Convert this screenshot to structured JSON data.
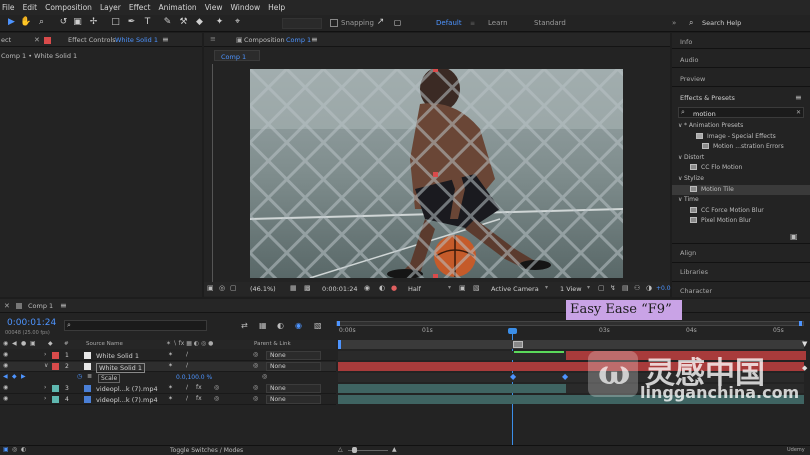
{
  "menubar": [
    "File",
    "Edit",
    "Composition",
    "Layer",
    "Effect",
    "Animation",
    "View",
    "Window",
    "Help"
  ],
  "toolbar": {
    "snapping_label": "Snapping",
    "workspaces": [
      "Default",
      "Learn",
      "Standard"
    ],
    "search_placeholder": "Search Help"
  },
  "effect_controls": {
    "tab_prefix": "ect",
    "tab_label": "Effect Controls",
    "tab_target": "White Solid 1",
    "subtitle": "Comp 1 • White Solid 1"
  },
  "composition": {
    "tab_label": "Composition",
    "tab_target": "Comp 1",
    "sub_tab": "Comp 1",
    "footer": {
      "zoom": "(46.1%)",
      "timecode": "0:00:01:24",
      "resolution": "Half",
      "camera": "Active Camera",
      "views": "1 View",
      "offset": "+0.0"
    }
  },
  "right_panel": {
    "sections_top": [
      "Info",
      "Audio",
      "Preview",
      "Effects & Presets"
    ],
    "search_value": "motion",
    "tree": [
      {
        "label": "* Animation Presets",
        "indent": 0,
        "kind": "group"
      },
      {
        "label": "Image - Special Effects",
        "indent": 1,
        "kind": "folder"
      },
      {
        "label": "Motion ...stration Errors",
        "indent": 2,
        "kind": "item"
      },
      {
        "label": "Distort",
        "indent": 0,
        "kind": "group"
      },
      {
        "label": "CC Flo Motion",
        "indent": 1,
        "kind": "item"
      },
      {
        "label": "Stylize",
        "indent": 0,
        "kind": "group"
      },
      {
        "label": "Motion Tile",
        "indent": 1,
        "kind": "item",
        "selected": true
      },
      {
        "label": "Time",
        "indent": 0,
        "kind": "group"
      },
      {
        "label": "CC Force Motion Blur",
        "indent": 1,
        "kind": "item"
      },
      {
        "label": "Pixel Motion Blur",
        "indent": 1,
        "kind": "item"
      }
    ],
    "sections_bottom": [
      "Align",
      "Libraries",
      "Character"
    ]
  },
  "timeline": {
    "tab_label": "Comp 1",
    "timecode": "0:00:01:24",
    "fps": "00048 (25.00 fps)",
    "search_placeholder": "",
    "columns": {
      "source": "Source Name",
      "parent": "Parent & Link"
    },
    "ruler": [
      "0:00s",
      "01s",
      "03s",
      "04s",
      "05s"
    ],
    "layers": [
      {
        "num": "1",
        "name": "White Solid 1",
        "color": "#d94b4b",
        "type": "solid",
        "parent": "None",
        "selected": false
      },
      {
        "num": "2",
        "name": "White Solid 1",
        "color": "#d94b4b",
        "type": "solid",
        "parent": "None",
        "selected": true
      },
      {
        "num": "3",
        "name": "videopl...k (7).mp4",
        "color": "#5fb8b0",
        "type": "footage",
        "parent": "None",
        "selected": false
      },
      {
        "num": "4",
        "name": "videopl...k (7).mp4",
        "color": "#5fb8b0",
        "type": "footage",
        "parent": "None",
        "selected": false
      }
    ],
    "property": {
      "name": "Scale",
      "value": "0.0,100.0 %"
    },
    "toggle_label": "Toggle Switches / Modes"
  },
  "overlay": {
    "caption": "Easy Ease “F9”",
    "watermark_cn": "灵感中国",
    "watermark_url": "lingganchina.com",
    "udemy": "Udemy"
  },
  "colors": {
    "accent": "#4d94ff",
    "red_layer": "#a83b3b",
    "teal_layer": "#3f6462",
    "playhead": "#3b8ee8",
    "caption_bg": "#c9a3e6"
  }
}
